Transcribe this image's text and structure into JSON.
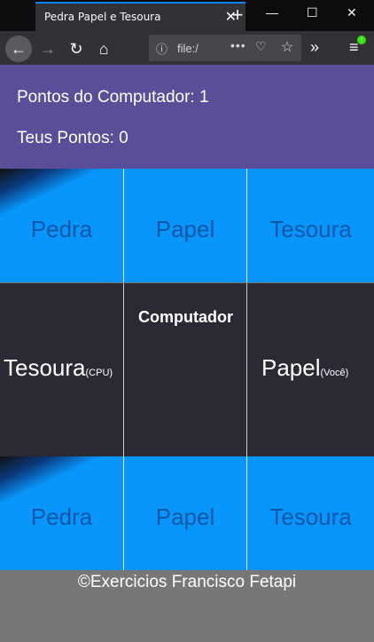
{
  "browser": {
    "tab_title": "Pedra Papel e Tesoura",
    "url": "file:/"
  },
  "score": {
    "computer_label": "Pontos do Computador: 1",
    "player_label": "Teus Pontos: 0"
  },
  "choices": {
    "rock": "Pedra",
    "paper": "Papel",
    "scissors": "Tesoura"
  },
  "result": {
    "computer_pick": "Tesoura",
    "computer_tag": "(CPU)",
    "winner_label": "Computador",
    "player_pick": "Papel",
    "player_tag": "(Você)"
  },
  "footer": {
    "text": "©Exercicios Francisco Fetapi"
  },
  "colors": {
    "scoreboard_bg": "#5b4e98",
    "choice_bg": "#0896fb",
    "result_bg": "#2b2a33",
    "footer_bg": "#777777"
  }
}
